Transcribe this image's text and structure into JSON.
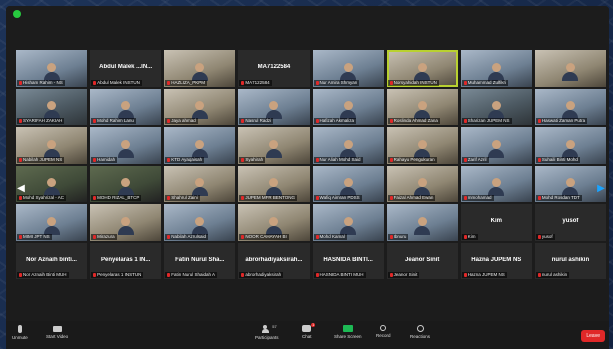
{
  "tiles": [
    {
      "label": "Hisham Rahim - NS",
      "type": "video",
      "v": "c"
    },
    {
      "label": "Abdul Malek INSTUN",
      "type": "name",
      "center": "Abdul Malek ...IN..."
    },
    {
      "label": "HAZLIZA_PKPM",
      "type": "video",
      "v": "b"
    },
    {
      "label": "MA7122584",
      "type": "name",
      "center": "MA7122584"
    },
    {
      "label": "Nur Amira Shmyan",
      "type": "video",
      "v": "c"
    },
    {
      "label": "Norsyahidah INSTUN",
      "type": "video",
      "v": "b",
      "speaking": true
    },
    {
      "label": "Muhammad Zulfikri",
      "type": "video",
      "v": "c"
    },
    {
      "label": "",
      "type": "video",
      "v": "b"
    },
    {
      "label": "SYARIFAH ZAKIAH",
      "type": "video",
      "v": "a"
    },
    {
      "label": "Mohd Rahim Lanu",
      "type": "video",
      "v": "c"
    },
    {
      "label": "Jaya ahmad",
      "type": "video",
      "v": "b"
    },
    {
      "label": "Nasrul Radzi",
      "type": "video",
      "v": "c"
    },
    {
      "label": "Hafizah Akmaliza",
      "type": "video",
      "v": "c"
    },
    {
      "label": "Roslinda Ahmad Zana",
      "type": "video",
      "v": "b"
    },
    {
      "label": "Sharizan JUPEM NS",
      "type": "video",
      "v": "a"
    },
    {
      "label": "Haswati Zaman Putra",
      "type": "video",
      "v": "c"
    },
    {
      "label": "Nabilah JUPEM NS",
      "type": "video",
      "v": "b"
    },
    {
      "label": "Hamidah",
      "type": "video",
      "v": "c"
    },
    {
      "label": "KTD Ayaqaisah",
      "type": "video",
      "v": "c"
    },
    {
      "label": "Syahirah",
      "type": "video",
      "v": "b"
    },
    {
      "label": "Nur Aliah Mohd Said",
      "type": "video",
      "v": "c"
    },
    {
      "label": "Rahayu Pengukuran",
      "type": "video",
      "v": "b"
    },
    {
      "label": "Zarif Azril",
      "type": "video",
      "v": "c"
    },
    {
      "label": "Suhaili Binti Mohd",
      "type": "video",
      "v": "c"
    },
    {
      "label": "Mohd Syahrizal - AC",
      "type": "video",
      "v": "d"
    },
    {
      "label": "MOHD RIZAL_BTCP",
      "type": "video",
      "v": "d"
    },
    {
      "label": "Shahrul Zaini",
      "type": "video",
      "v": "b"
    },
    {
      "label": "JUPEM MFR BENTONG",
      "type": "video",
      "v": "b"
    },
    {
      "label": "Wafiq Aimran PDSS",
      "type": "video",
      "v": "c"
    },
    {
      "label": "Faizal Ahmad Ewan",
      "type": "video",
      "v": "b"
    },
    {
      "label": "mmohamad",
      "type": "video",
      "v": "c"
    },
    {
      "label": "Mohd Rosdan TDT",
      "type": "video",
      "v": "c"
    },
    {
      "label": "MIMI JPT NS",
      "type": "video",
      "v": "c"
    },
    {
      "label": "Mirazura",
      "type": "video",
      "v": "b"
    },
    {
      "label": "Nabilah Azrulsaid",
      "type": "video",
      "v": "c"
    },
    {
      "label": "NOOR CAHAYAH BI",
      "type": "video",
      "v": "b"
    },
    {
      "label": "Mohd Kamal",
      "type": "video",
      "v": "c"
    },
    {
      "label": "Ibnuru",
      "type": "video",
      "v": "c"
    },
    {
      "label": "Kim",
      "type": "name",
      "center": "Kim"
    },
    {
      "label": "yusof",
      "type": "name",
      "center": "yusof"
    },
    {
      "label": "Nor Aznaih Binti MUH",
      "type": "name",
      "center": "Nor Aznaih binti..."
    },
    {
      "label": "Penyelaras 1 INSTUN",
      "type": "name",
      "center": "Penyelaras 1 IN..."
    },
    {
      "label": "Fatin Nurul Shaidah A",
      "type": "name",
      "center": "Fatin Nurul Sha..."
    },
    {
      "label": "abrorhadiyaksirah",
      "type": "name",
      "center": "abrorhadiyaksirah..."
    },
    {
      "label": "HASNIDA BINTI MUH",
      "type": "name",
      "center": "HASNIDA BINTI..."
    },
    {
      "label": "Jeanor Sinit",
      "type": "name",
      "center": "Jeanor Sinit"
    },
    {
      "label": "Hazna JUPEM NS",
      "type": "name",
      "center": "Hazna JUPEM NS"
    },
    {
      "label": "nurul ashikin",
      "type": "name",
      "center": "nurul ashikin"
    }
  ],
  "toolbar": {
    "unmute": "Unmute",
    "start_video": "Start Video",
    "participants": "Participants",
    "participants_count": "57",
    "chat": "Chat",
    "chat_badge": "1",
    "share_screen": "Share Screen",
    "record": "Record",
    "reactions": "Reactions",
    "leave": "Leave"
  },
  "colors": {
    "speaking": "#b9d130",
    "mute": "#e02828",
    "share": "#1db954",
    "leave": "#e02828"
  }
}
